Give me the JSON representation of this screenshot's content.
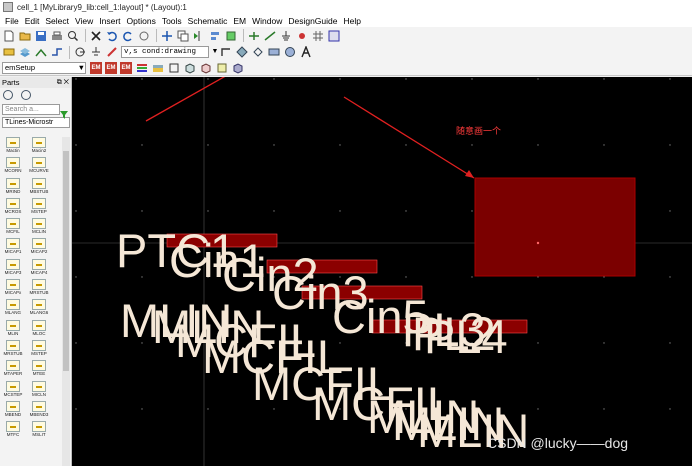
{
  "window": {
    "title": "cell_1 [MyLibrary9_lib:cell_1:layout] * (Layout):1"
  },
  "menu": [
    "File",
    "Edit",
    "Select",
    "View",
    "Insert",
    "Options",
    "Tools",
    "Schematic",
    "EM",
    "Window",
    "DesignGuide",
    "Help"
  ],
  "toolbar": {
    "command_value": "v,s cond:drawing",
    "setup_value": "emSetup"
  },
  "parts_panel": {
    "title": "Parts",
    "search_placeholder": "Search a...",
    "library": "TLines-Microstr",
    "items": [
      "Mactin",
      "Macin2",
      "MCORN",
      "MCURVE",
      "MRIND",
      "MBSTUB",
      "MCROS",
      "MSTEP",
      "MCFIL",
      "MCLIN",
      "MICAP1",
      "MICAP2",
      "MICAP3",
      "MICAP4",
      "MICAPx",
      "MRSTUB",
      "MLANG",
      "MLANG6",
      "MLIN",
      "MLOC",
      "MRSTUB",
      "MSTEP",
      "MTAPER",
      "MTEE",
      "MCSTEP",
      "MICLN",
      "MBEND",
      "MBEND3",
      "MTFC",
      "MSLIT"
    ]
  },
  "canvas": {
    "background": "#000000",
    "text_color": "#f5e7d6",
    "labels": [
      "PTC1",
      "Cin1",
      "Cin2",
      "Cin3",
      "Cin5",
      "PL3",
      "PL2",
      "PL4",
      "MLIN",
      "MLIN",
      "MCFIL",
      "MCFIL",
      "MCFIL",
      "MCFIL",
      "MLIN",
      "MLIN",
      "MLIN"
    ],
    "annotation": "随意画一个",
    "rect_color": "#7b0000"
  },
  "watermark": "CSDN @lucky——dog"
}
